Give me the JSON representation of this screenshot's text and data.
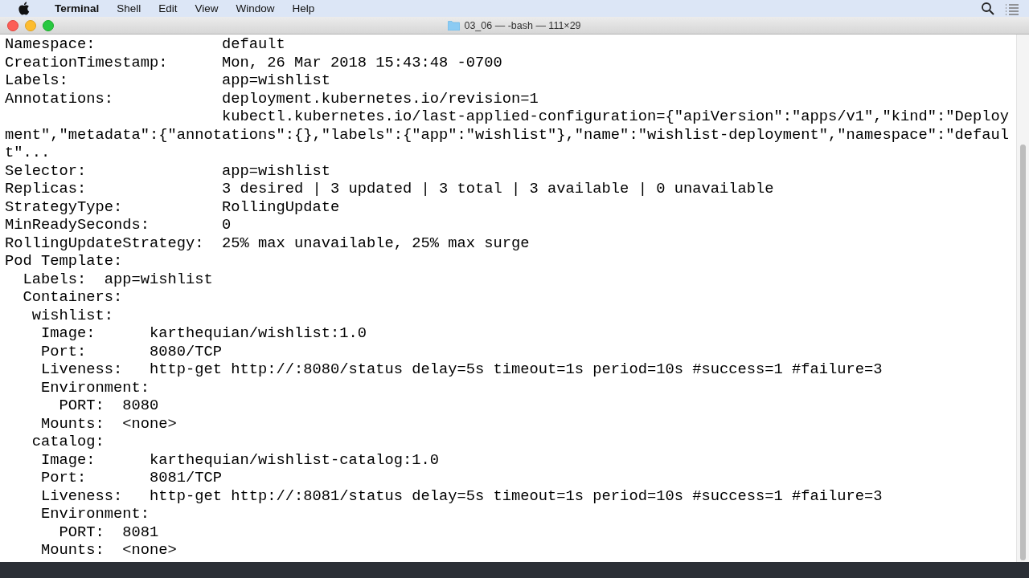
{
  "menubar": {
    "app_name": "Terminal",
    "items": [
      {
        "label": "Shell"
      },
      {
        "label": "Edit"
      },
      {
        "label": "View"
      },
      {
        "label": "Window"
      },
      {
        "label": "Help"
      }
    ]
  },
  "window": {
    "title": "03_06 — -bash — 111×29"
  },
  "terminal": {
    "lines": [
      "Namespace:              default",
      "CreationTimestamp:      Mon, 26 Mar 2018 15:43:48 -0700",
      "Labels:                 app=wishlist",
      "Annotations:            deployment.kubernetes.io/revision=1",
      "                        kubectl.kubernetes.io/last-applied-configuration={\"apiVersion\":\"apps/v1\",\"kind\":\"Deploy",
      "ment\",\"metadata\":{\"annotations\":{},\"labels\":{\"app\":\"wishlist\"},\"name\":\"wishlist-deployment\",\"namespace\":\"defaul",
      "t\"...",
      "Selector:               app=wishlist",
      "Replicas:               3 desired | 3 updated | 3 total | 3 available | 0 unavailable",
      "StrategyType:           RollingUpdate",
      "MinReadySeconds:        0",
      "RollingUpdateStrategy:  25% max unavailable, 25% max surge",
      "Pod Template:",
      "  Labels:  app=wishlist",
      "  Containers:",
      "   wishlist:",
      "    Image:      karthequian/wishlist:1.0",
      "    Port:       8080/TCP",
      "    Liveness:   http-get http://:8080/status delay=5s timeout=1s period=10s #success=1 #failure=3",
      "    Environment:",
      "      PORT:  8080",
      "    Mounts:  <none>",
      "   catalog:",
      "    Image:      karthequian/wishlist-catalog:1.0",
      "    Port:       8081/TCP",
      "    Liveness:   http-get http://:8081/status delay=5s timeout=1s period=10s #success=1 #failure=3",
      "    Environment:",
      "      PORT:  8081",
      "    Mounts:  <none>"
    ]
  }
}
